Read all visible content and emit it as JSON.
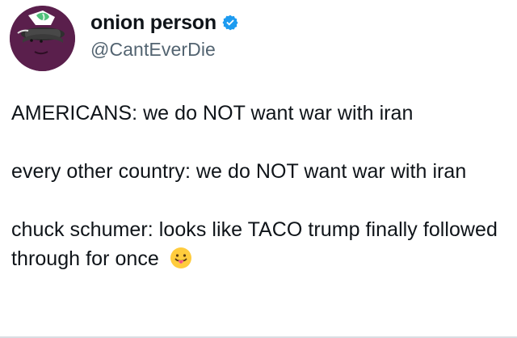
{
  "author": {
    "display_name": "onion person",
    "handle": "@CantEverDie",
    "verified_color": "#1d9bf0"
  },
  "avatar": {
    "icon": "purple-onion-avatar",
    "background_color": "#5a1f4c",
    "band_color": "#2f2f2f",
    "leaf_color": "#4fc07a"
  },
  "tweet": {
    "paragraphs": [
      "AMERICANS:  we do NOT want war with iran",
      "every other country:  we do NOT want war with iran",
      "chuck schumer:  looks like TACO trump finally followed through for once"
    ],
    "trailing_emoji": "face-with-tongue"
  }
}
